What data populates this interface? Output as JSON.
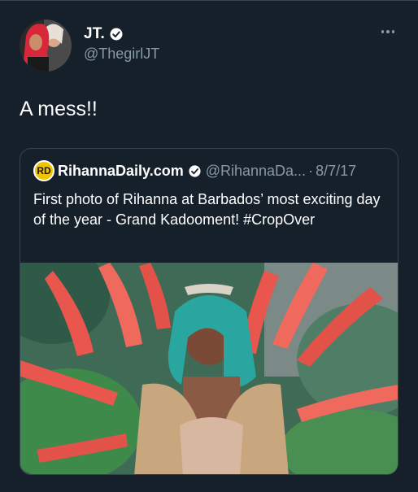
{
  "tweet": {
    "display_name": "JT.",
    "handle": "@ThegirlJT",
    "text": "A mess!!"
  },
  "quoted_tweet": {
    "logo_text": "RD",
    "display_name": "RihannaDaily.com",
    "handle": "@RihannaDa...",
    "separator": "·",
    "date": "8/7/17",
    "text": "First photo of Rihanna at Barbados’ most exciting day of the year - Grand Kadooment! #CropOver"
  },
  "icons": {
    "verified": "verified-badge-icon",
    "more": "more-options-icon"
  },
  "colors": {
    "background": "#15202b",
    "border": "#38444d",
    "secondary_text": "#8899a6",
    "logo_yellow": "#f2c300"
  }
}
